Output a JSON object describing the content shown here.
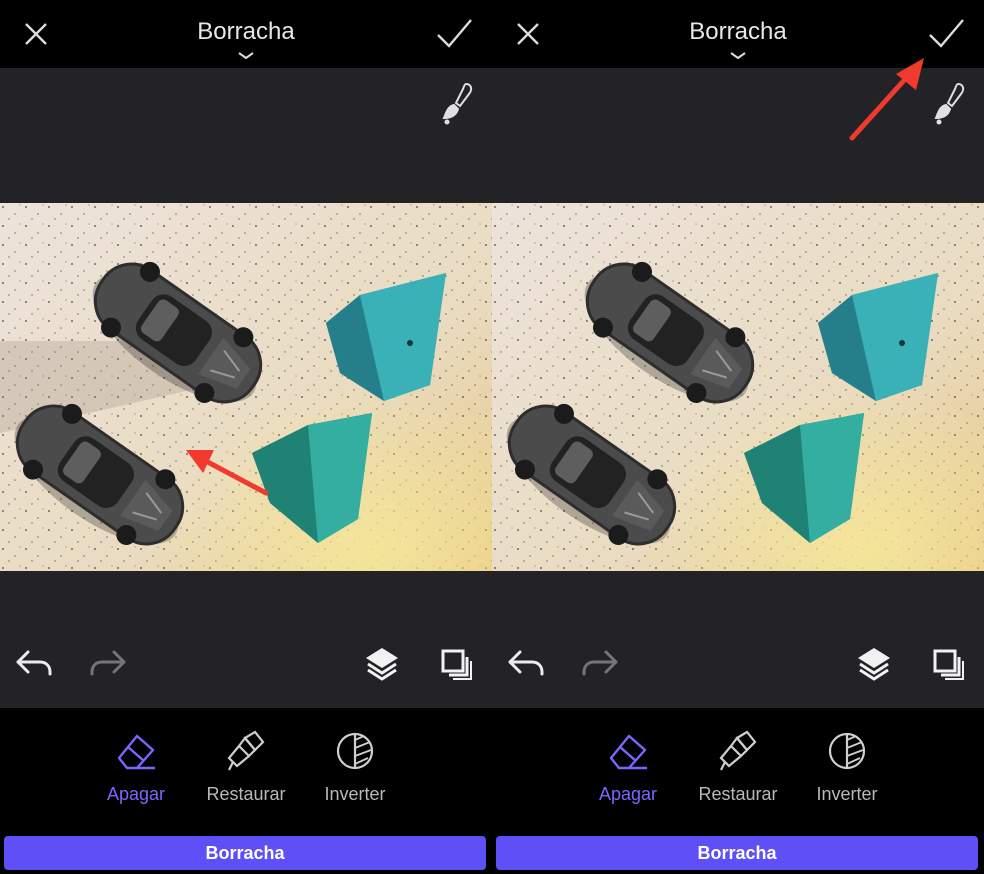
{
  "panels": [
    {
      "header": {
        "title": "Borracha",
        "close_icon": "close-icon",
        "confirm_icon": "checkmark-icon",
        "chevron_icon": "chevron-down-icon"
      },
      "canvas": {
        "brush_icon": "brush-settings-icon",
        "background_color": "#232226"
      },
      "actions": {
        "undo_icon": "undo-icon",
        "redo_icon": "redo-icon",
        "layers_icon": "layers-icon",
        "duplicate_icon": "duplicate-icon"
      },
      "tools": [
        {
          "label": "Apagar",
          "icon": "eraser-icon",
          "active": true
        },
        {
          "label": "Restaurar",
          "icon": "paintbrush-icon",
          "active": false
        },
        {
          "label": "Inverter",
          "icon": "invert-icon",
          "active": false
        }
      ],
      "mode_button": "Borracha"
    },
    {
      "header": {
        "title": "Borracha",
        "close_icon": "close-icon",
        "confirm_icon": "checkmark-icon",
        "chevron_icon": "chevron-down-icon"
      },
      "canvas": {
        "brush_icon": "brush-settings-icon",
        "background_color": "#232226"
      },
      "actions": {
        "undo_icon": "undo-icon",
        "redo_icon": "redo-icon",
        "layers_icon": "layers-icon",
        "duplicate_icon": "duplicate-icon"
      },
      "tools": [
        {
          "label": "Apagar",
          "icon": "eraser-icon",
          "active": true
        },
        {
          "label": "Restaurar",
          "icon": "paintbrush-icon",
          "active": false
        },
        {
          "label": "Inverter",
          "icon": "invert-icon",
          "active": false
        }
      ],
      "mode_button": "Borracha"
    }
  ],
  "colors": {
    "accent": "#5f4ff6",
    "active_label": "#7a66ff",
    "annotation_arrow": "#f03a2e"
  }
}
